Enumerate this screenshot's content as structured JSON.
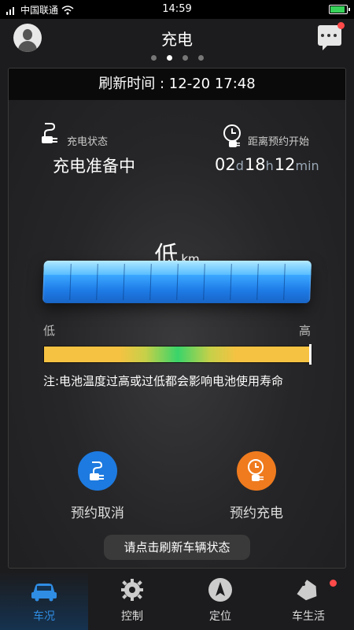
{
  "status_bar": {
    "carrier": "中国联通",
    "time": "14:59"
  },
  "header": {
    "title": "充电",
    "pages": 4,
    "active_page": 1
  },
  "refresh": {
    "text": "刷新时间 : 12-20 17:48"
  },
  "charge_status": {
    "label": "充电状态",
    "value": "充电准备中"
  },
  "countdown": {
    "label": "距离预约开始",
    "days": "02",
    "day_unit": "d",
    "hours": "18",
    "hour_unit": "h",
    "minutes": "12",
    "minute_unit": "min"
  },
  "range": {
    "value": "低",
    "unit": "km"
  },
  "temperature": {
    "low_label": "低",
    "high_label": "高",
    "level": 1.0,
    "note": "注:电池温度过高或过低都会影响电池使用寿命"
  },
  "actions": {
    "cancel_label": "预约取消",
    "book_label": "预约充电"
  },
  "toast": {
    "text": "请点击刷新车辆状态"
  },
  "tabs": [
    {
      "label": "车况",
      "icon": "car-icon",
      "active": true
    },
    {
      "label": "控制",
      "icon": "gear-icon",
      "active": false
    },
    {
      "label": "定位",
      "icon": "navigation-icon",
      "active": false
    },
    {
      "label": "车生活",
      "icon": "tag-icon",
      "active": false
    }
  ],
  "colors": {
    "accent_blue": "#1d7ae0",
    "accent_orange": "#ef7b1e",
    "badge_red": "#ff4a4a",
    "tab_active": "#2f8de4"
  }
}
